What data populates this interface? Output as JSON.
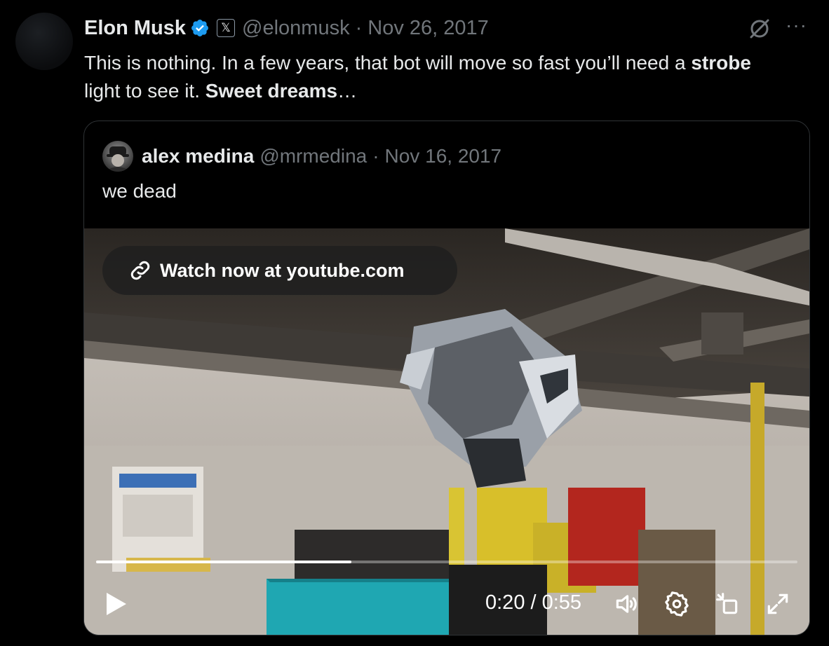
{
  "tweet": {
    "author_name": "Elon Musk",
    "x_badge": "𝕏",
    "handle": "@elonmusk",
    "separator": "·",
    "date": "Nov 26, 2017",
    "more": "···",
    "text_part1": "This is nothing. In a few years, that bot will move so fast you’ll need a ",
    "text_bold1": "strobe",
    "text_part2": " light to see it. ",
    "text_bold2": "Sweet dreams",
    "text_part3": "…"
  },
  "quote": {
    "author_name": "alex medina",
    "handle": "@mrmedina",
    "separator": "·",
    "date": "Nov 16, 2017",
    "text": "we dead"
  },
  "video": {
    "watch_label": "Watch now at youtube.com",
    "time_display": "0:20 / 0:55",
    "progress": 0.364,
    "icons": [
      "link-icon",
      "play-icon",
      "volume-icon",
      "settings-icon",
      "pip-icon",
      "fullscreen-icon"
    ]
  },
  "colors": {
    "background": "#000000",
    "text": "#e7e9ea",
    "muted": "#71767b",
    "verified": "#1d9bf0",
    "border": "#2f3336"
  }
}
